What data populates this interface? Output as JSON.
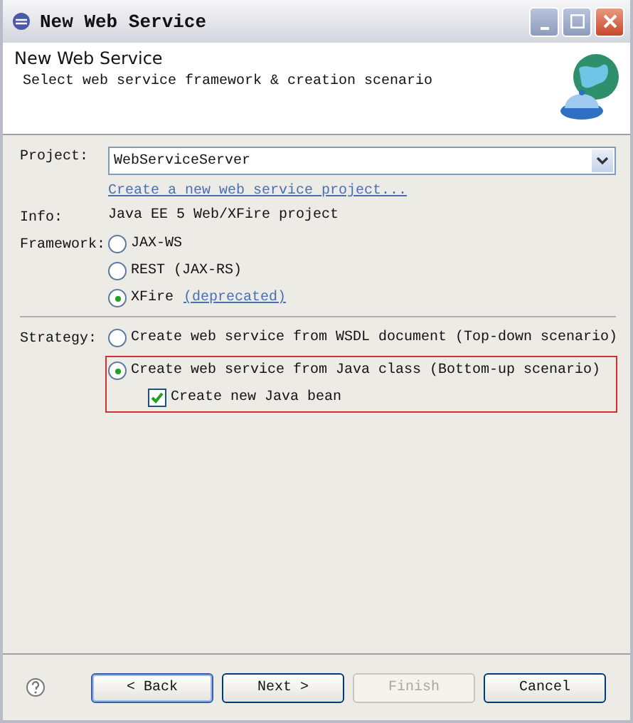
{
  "window": {
    "title": "New Web Service"
  },
  "header": {
    "title": "New Web Service",
    "description": "Select web service framework & creation scenario"
  },
  "project": {
    "label": "Project:",
    "value": "WebServiceServer",
    "link": "Create a new web service project..."
  },
  "info": {
    "label": "Info:",
    "value": "Java EE 5 Web/XFire project"
  },
  "framework": {
    "label": "Framework:",
    "options": [
      {
        "label": "JAX-WS",
        "selected": false
      },
      {
        "label": "REST (JAX-RS)",
        "selected": false
      },
      {
        "label": "XFire",
        "selected": true,
        "link": "(deprecated)"
      }
    ]
  },
  "strategy": {
    "label": "Strategy:",
    "options": [
      {
        "label": "Create web service from WSDL document (Top-down scenario)",
        "selected": false,
        "highlighted": false
      },
      {
        "label": "Create web service from Java class (Bottom-up scenario)",
        "selected": true,
        "highlighted": true
      }
    ],
    "checkbox": {
      "label": "Create new Java bean",
      "checked": true
    }
  },
  "buttons": [
    {
      "label": "< Back",
      "disabled": false,
      "focused": true
    },
    {
      "label": "Next >",
      "disabled": false,
      "focused": false
    },
    {
      "label": "Finish",
      "disabled": true,
      "focused": false
    },
    {
      "label": "Cancel",
      "disabled": false,
      "focused": false
    }
  ]
}
